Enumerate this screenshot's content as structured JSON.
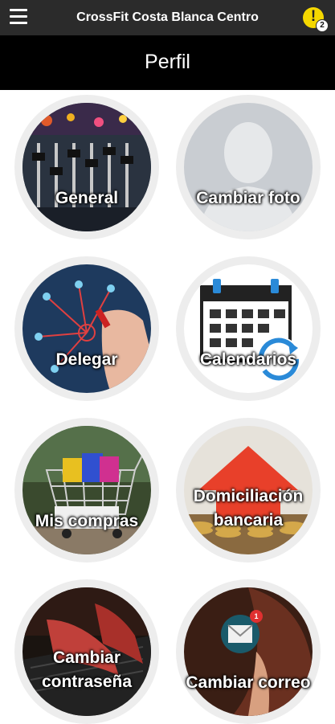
{
  "header": {
    "app_title": "CrossFit Costa Blanca Centro",
    "alert_mark": "!",
    "notification_count": "2"
  },
  "page": {
    "title": "Perfil"
  },
  "tiles": [
    {
      "label": "General",
      "icon": "mixing-console-photo"
    },
    {
      "label": "Cambiar foto",
      "icon": "avatar-silhouette"
    },
    {
      "label": "Delegar",
      "icon": "network-hand-photo"
    },
    {
      "label": "Calendarios",
      "icon": "calendar-sync"
    },
    {
      "label": "Mis compras",
      "icon": "shopping-cart-photo"
    },
    {
      "label": "Domiciliación bancaria",
      "line1": "Domiciliación",
      "line2": "bancaria",
      "icon": "house-coins-photo"
    },
    {
      "label": "Cambiar contraseña",
      "line1": "Cambiar",
      "line2": "contraseña",
      "icon": "laptop-typing-photo"
    },
    {
      "label": "Cambiar correo",
      "icon": "email-envelope",
      "badge": "1"
    }
  ],
  "colors": {
    "topbar": "#2b2b2b",
    "pagebar": "#000000",
    "alert": "#f5d800",
    "tile_ring": "#ededed"
  }
}
